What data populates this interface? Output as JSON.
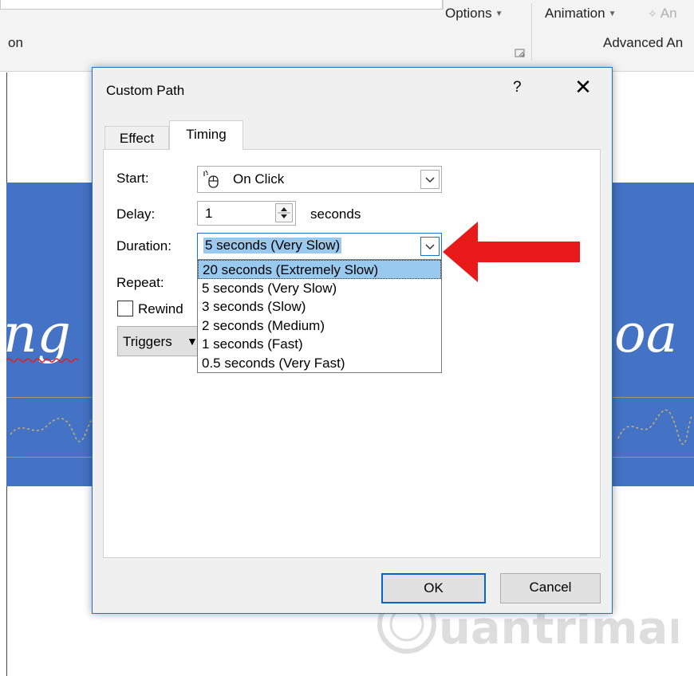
{
  "ribbon": {
    "left_text": "on",
    "options_label": "Options",
    "animation_label": "Animation",
    "extra_label": "An",
    "advanced_label": "Advanced An"
  },
  "slide": {
    "left_text": "ng",
    "right_text": "oa"
  },
  "watermark": {
    "text": "Quantrimang"
  },
  "dialog": {
    "title": "Custom Path",
    "help": "?",
    "close": "✕",
    "tabs": [
      "Effect",
      "Timing"
    ],
    "start": {
      "label": "Start:",
      "value": "On Click"
    },
    "delay": {
      "label": "Delay:",
      "value": "1",
      "unit": "seconds"
    },
    "duration": {
      "label": "Duration:",
      "value": "5 seconds (Very Slow)",
      "options": [
        "20 seconds (Extremely Slow)",
        "5 seconds (Very Slow)",
        "3 seconds (Slow)",
        "2 seconds (Medium)",
        "1 seconds (Fast)",
        "0.5 seconds (Very Fast)"
      ]
    },
    "repeat": {
      "label": "Repeat:"
    },
    "rewind": {
      "label": "Rewind"
    },
    "triggers": {
      "label": "Triggers"
    },
    "ok": "OK",
    "cancel": "Cancel"
  },
  "colors": {
    "accent": "#1a73c9",
    "slide_band": "#4472c4",
    "selection": "#99c9ef",
    "arrow": "#e81a1a"
  }
}
